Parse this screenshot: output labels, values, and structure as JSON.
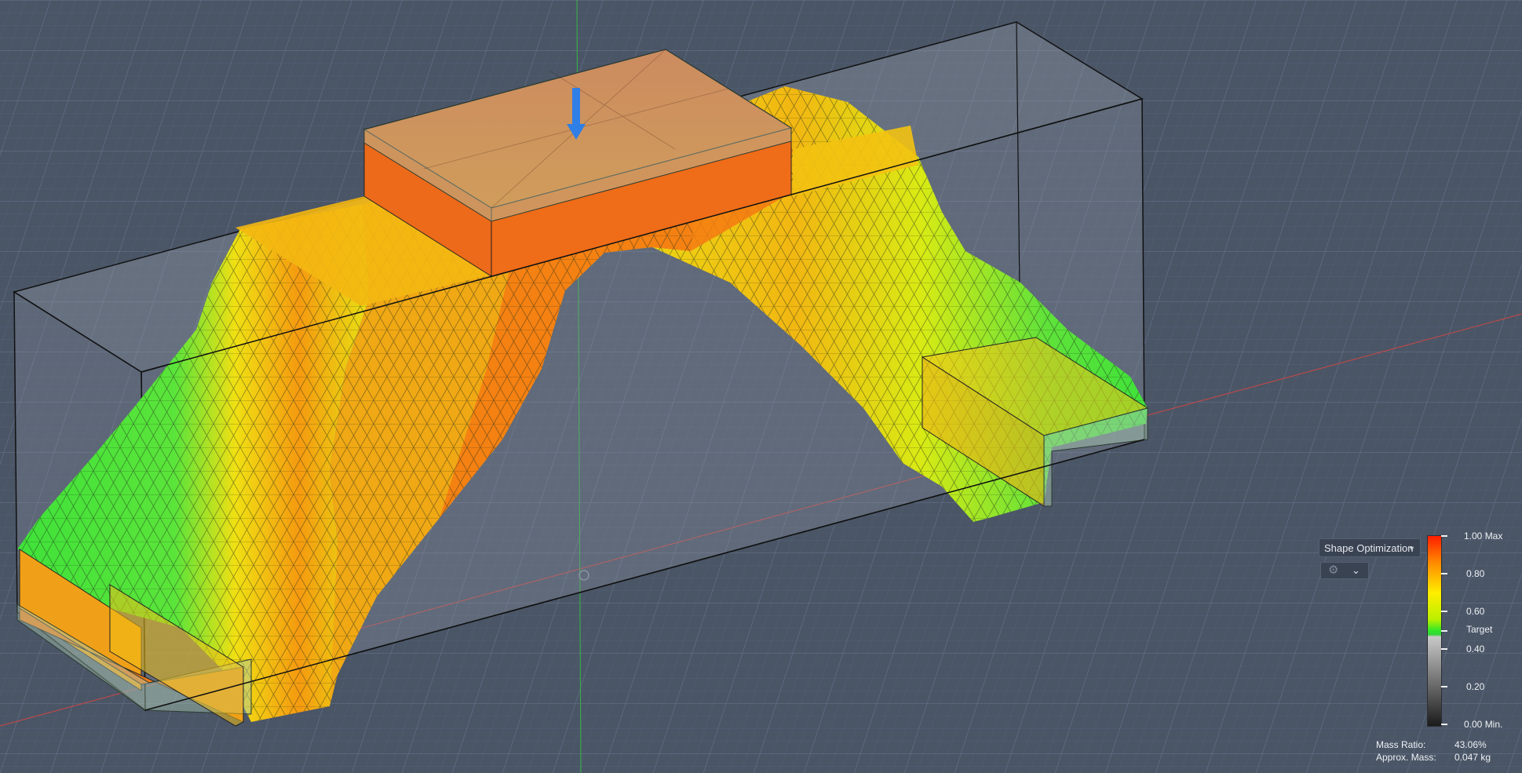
{
  "study_selector": {
    "label": "Shape Optimization"
  },
  "legend": {
    "labels": {
      "max": "1.00 Max",
      "v080": "0.80",
      "v060": "0.60",
      "target": "Target",
      "v040": "0.40",
      "v020": "0.20",
      "min": "0.00 Min."
    }
  },
  "stats": {
    "mass_ratio_label": "Mass Ratio:",
    "mass_ratio_value": "43.06%",
    "approx_mass_label": "Approx. Mass:",
    "approx_mass_value": "0.047 kg"
  },
  "colors": {
    "background": "#4a5566",
    "grid": "#5c6779",
    "result_red": "#f03a0e",
    "result_orange": "#f58a10",
    "result_yellow": "#e6e613",
    "result_green": "#3fe23a",
    "load_arrow": "#2f7fe6",
    "preserve_region": "#a8c7b0",
    "x_axis": "#b84a4a",
    "y_axis": "#3aa84a"
  },
  "icons": {
    "dropdown": "caret-down-icon",
    "settings": "gear-icon",
    "expand": "chevron-down-icon",
    "load": "arrow-down-icon"
  }
}
